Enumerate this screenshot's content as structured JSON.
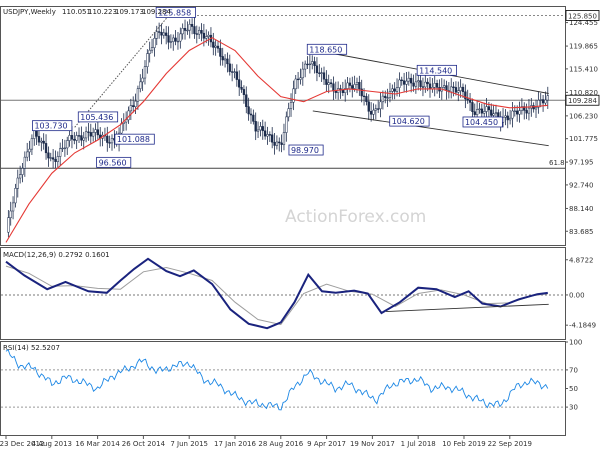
{
  "chart_data": [
    {
      "pane": "price",
      "type": "candlestick",
      "title": "USDJPY,Weekly",
      "ohlc_header": {
        "open": "110.051",
        "high": "110.223",
        "low": "109.173",
        "close": "109.284"
      },
      "watermark": "ActionForex.com",
      "ylim": [
        81.0,
        127.5
      ],
      "y_ticks": [
        "83.685",
        "88.140",
        "92.740",
        "97.195",
        "101.775",
        "106.230",
        "110.820",
        "115.410",
        "119.865",
        "124.455"
      ],
      "last_price_label": "109.284",
      "high_marker_label": "125.850",
      "fib_label": "61.8",
      "fib_level": 96.0,
      "pivot_high_level": 125.85,
      "current_level_line": 109.284,
      "x_tick_labels": [
        "23 Dec 2012",
        "4 Aug 2013",
        "16 Mar 2014",
        "26 Oct 2014",
        "7 Jun 2015",
        "17 Jan 2016",
        "28 Aug 2016",
        "9 Apr 2017",
        "19 Nov 2017",
        "1 Jul 2018",
        "10 Feb 2019",
        "22 Sep 2019"
      ],
      "annotations": [
        {
          "label": "103.730",
          "x": 0.6,
          "y": 103.73
        },
        {
          "label": "96.560",
          "x": 2.0,
          "y": 96.56
        },
        {
          "label": "105.436",
          "x": 1.6,
          "y": 105.44
        },
        {
          "label": "101.088",
          "x": 2.4,
          "y": 101.09
        },
        {
          "label": "125.858",
          "x": 3.3,
          "y": 125.86
        },
        {
          "label": "98.970",
          "x": 6.2,
          "y": 98.97
        },
        {
          "label": "118.650",
          "x": 6.6,
          "y": 118.65
        },
        {
          "label": "104.620",
          "x": 8.4,
          "y": 104.62
        },
        {
          "label": "114.540",
          "x": 9.0,
          "y": 114.54
        },
        {
          "label": "104.450",
          "x": 10.0,
          "y": 104.45
        }
      ],
      "series": [
        {
          "name": "price",
          "style": "candles",
          "x": [
            0,
            0.3,
            0.6,
            1.0,
            1.4,
            1.8,
            2.1,
            2.4,
            2.8,
            3.1,
            3.35,
            3.7,
            4.0,
            4.3,
            4.7,
            5.1,
            5.45,
            5.8,
            6.0,
            6.3,
            6.6,
            6.9,
            7.3,
            7.7,
            8.0,
            8.3,
            8.6,
            9.0,
            9.3,
            9.6,
            10.0,
            10.2,
            10.5,
            10.8,
            11.0,
            11.3,
            11.6,
            11.83
          ],
          "values": [
            83.5,
            95.0,
            103.0,
            97.5,
            101.5,
            103.0,
            102.0,
            101.5,
            109.0,
            118.0,
            123.0,
            120.5,
            124.0,
            122.0,
            118.5,
            112.0,
            104.0,
            101.5,
            100.8,
            112.0,
            117.5,
            113.5,
            111.0,
            112.5,
            106.0,
            110.5,
            112.5,
            113.0,
            111.5,
            112.0,
            110.5,
            107.5,
            107.0,
            106.0,
            106.0,
            107.5,
            108.5,
            109.28
          ]
        },
        {
          "name": "moving-average",
          "style": "line",
          "color": "#e53935",
          "x": [
            0,
            0.5,
            1.0,
            1.5,
            2.0,
            2.5,
            3.0,
            3.5,
            4.0,
            4.5,
            5.0,
            5.5,
            6.0,
            6.5,
            7.0,
            7.5,
            8.0,
            8.5,
            9.0,
            9.5,
            10.0,
            10.5,
            11.0,
            11.5,
            11.83
          ],
          "values": [
            81.5,
            89.0,
            95.0,
            99.0,
            101.5,
            104.5,
            109.0,
            114.5,
            119.0,
            121.5,
            119.0,
            114.0,
            110.0,
            109.0,
            111.0,
            111.5,
            111.0,
            110.5,
            111.5,
            111.5,
            110.0,
            108.5,
            107.8,
            108.0,
            108.3
          ]
        },
        {
          "name": "channel-upper",
          "style": "line",
          "color": "#333333",
          "x": [
            6.6,
            11.85
          ],
          "values": [
            119.3,
            110.6
          ]
        },
        {
          "name": "channel-lower",
          "style": "line",
          "color": "#333333",
          "x": [
            6.7,
            11.85
          ],
          "values": [
            107.2,
            100.4
          ]
        }
      ]
    },
    {
      "pane": "macd",
      "type": "line",
      "title": "MACD(12,26,9) 0.2792 0.1601",
      "ylim": [
        -6.1,
        6.5
      ],
      "y_ticks": [
        "4.8722",
        "0.00",
        "-4.1849"
      ],
      "series": [
        {
          "name": "macd",
          "color": "#1a237e",
          "x": [
            0,
            0.4,
            0.9,
            1.3,
            1.8,
            2.2,
            2.5,
            2.8,
            3.1,
            3.5,
            3.8,
            4.1,
            4.5,
            4.9,
            5.3,
            5.7,
            6.0,
            6.3,
            6.6,
            6.9,
            7.2,
            7.6,
            7.9,
            8.2,
            8.6,
            9.0,
            9.4,
            9.8,
            10.1,
            10.4,
            10.8,
            11.2,
            11.6,
            11.83
          ],
          "values": [
            4.6,
            2.7,
            0.8,
            1.8,
            0.5,
            0.3,
            2.0,
            3.6,
            5.0,
            3.3,
            2.6,
            3.4,
            1.5,
            -2.0,
            -4.0,
            -4.6,
            -3.8,
            -1.0,
            2.8,
            0.5,
            0.3,
            0.6,
            0.2,
            -2.5,
            -1.0,
            1.0,
            0.8,
            -0.3,
            0.5,
            -1.2,
            -1.6,
            -0.6,
            0.1,
            0.28
          ]
        },
        {
          "name": "signal",
          "color": "#9e9e9e",
          "x": [
            0,
            0.5,
            1.0,
            1.5,
            2.0,
            2.5,
            3.0,
            3.5,
            4.0,
            4.5,
            5.0,
            5.5,
            6.0,
            6.5,
            7.0,
            7.5,
            8.0,
            8.5,
            9.0,
            9.5,
            10.0,
            10.5,
            11.0,
            11.5,
            11.83
          ],
          "values": [
            4.0,
            3.0,
            1.2,
            1.3,
            0.9,
            0.8,
            3.2,
            3.8,
            3.0,
            2.0,
            -1.0,
            -3.4,
            -4.1,
            0.2,
            1.5,
            0.5,
            0.1,
            -1.6,
            0.2,
            0.7,
            0.0,
            -1.2,
            -1.1,
            -0.1,
            0.16
          ]
        },
        {
          "name": "divergence-trendline",
          "color": "#333333",
          "x": [
            8.3,
            11.85
          ],
          "values": [
            -2.3,
            -1.3
          ]
        }
      ]
    },
    {
      "pane": "rsi",
      "type": "line",
      "title": "RSI(14) 52.5207",
      "ylim": [
        0,
        100
      ],
      "y_ticks": [
        "100",
        "70",
        "50",
        "30"
      ],
      "series": [
        {
          "name": "rsi",
          "color": "#1e88e5",
          "x": [
            0,
            0.3,
            0.6,
            1.0,
            1.3,
            1.6,
            2.0,
            2.3,
            2.6,
            3.0,
            3.3,
            3.6,
            4.0,
            4.3,
            4.6,
            5.0,
            5.3,
            5.6,
            6.0,
            6.3,
            6.6,
            6.9,
            7.2,
            7.5,
            7.8,
            8.1,
            8.4,
            8.7,
            9.0,
            9.3,
            9.6,
            9.9,
            10.2,
            10.5,
            10.8,
            11.1,
            11.4,
            11.7,
            11.83
          ],
          "values": [
            90,
            75,
            72,
            55,
            62,
            58,
            50,
            63,
            70,
            80,
            68,
            73,
            78,
            60,
            55,
            42,
            35,
            33,
            30,
            52,
            67,
            58,
            50,
            55,
            45,
            38,
            54,
            58,
            60,
            50,
            52,
            48,
            40,
            34,
            32,
            50,
            58,
            54,
            52.5
          ]
        }
      ]
    }
  ]
}
